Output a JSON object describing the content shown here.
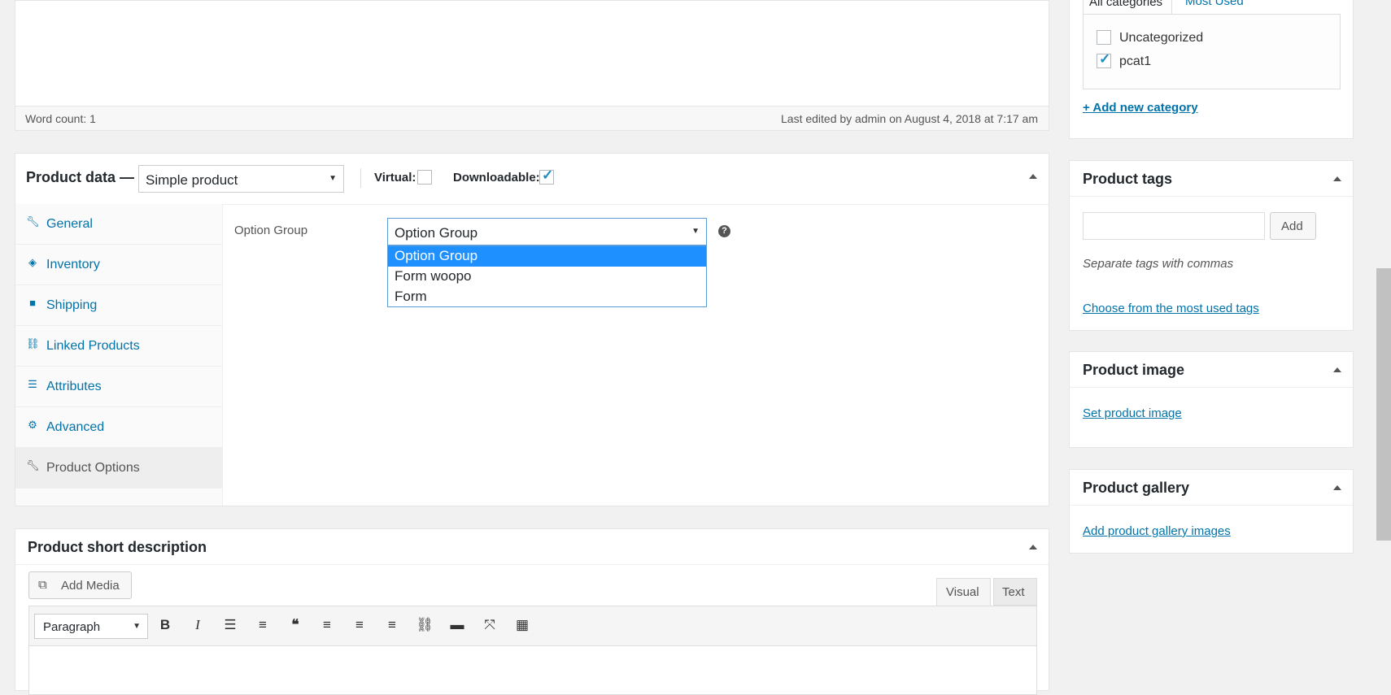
{
  "editor": {
    "word_count": "Word count: 1",
    "last_edited": "Last edited by admin on August 4, 2018 at 7:17 am"
  },
  "product_data": {
    "title": "Product data —",
    "type_select": "Simple product",
    "virtual_label": "Virtual:",
    "virtual_checked": false,
    "downloadable_label": "Downloadable:",
    "downloadable_checked": true,
    "tabs": [
      {
        "label": "General",
        "icon": "wrench-icon"
      },
      {
        "label": "Inventory",
        "icon": "tag-icon"
      },
      {
        "label": "Shipping",
        "icon": "truck-icon"
      },
      {
        "label": "Linked Products",
        "icon": "link-icon"
      },
      {
        "label": "Attributes",
        "icon": "list-icon"
      },
      {
        "label": "Advanced",
        "icon": "gear-icon"
      },
      {
        "label": "Product Options",
        "icon": "wrench-icon"
      }
    ],
    "active_tab": "Product Options",
    "option_group_label": "Option Group",
    "option_group_value": "Option Group",
    "option_group_options": [
      "Option Group",
      "Form woopo",
      "Form"
    ]
  },
  "short_description": {
    "title": "Product short description",
    "add_media": "Add Media",
    "tab_visual": "Visual",
    "tab_text": "Text",
    "format_select": "Paragraph"
  },
  "categories": {
    "tab_all": "All categories",
    "tab_most_used": "Most Used",
    "items": [
      {
        "label": "Uncategorized",
        "checked": false
      },
      {
        "label": "pcat1",
        "checked": true
      }
    ],
    "add_new": "+ Add new category"
  },
  "tags": {
    "title": "Product tags",
    "add_button": "Add",
    "hint": "Separate tags with commas",
    "choose_link": "Choose from the most used tags"
  },
  "product_image": {
    "title": "Product image",
    "set_link": "Set product image"
  },
  "product_gallery": {
    "title": "Product gallery",
    "add_link": "Add product gallery images"
  },
  "colors": {
    "accent": "#0073aa",
    "highlight": "#1e90ff"
  }
}
